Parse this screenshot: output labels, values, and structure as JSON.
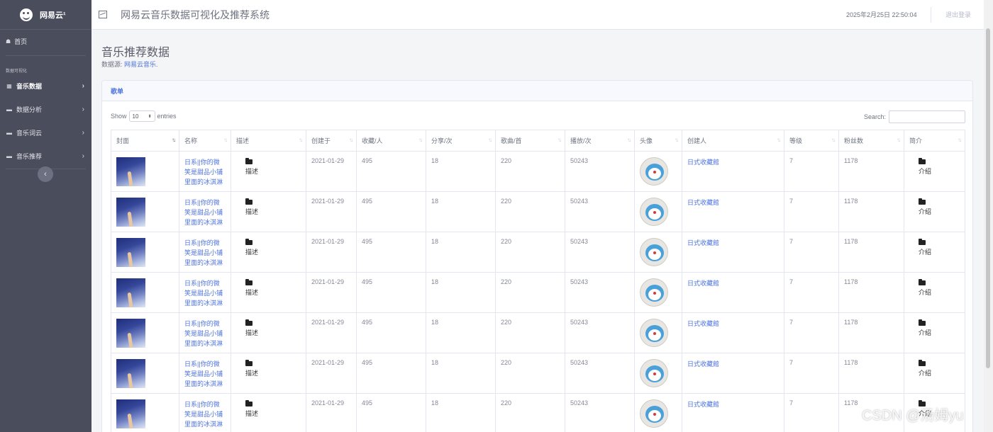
{
  "brand": {
    "name": "网易云¹"
  },
  "sidebar": {
    "home_label": "首页",
    "section_heading": "数据可视化",
    "items": [
      {
        "label": "音乐数据",
        "icon": "table-icon",
        "active": true
      },
      {
        "label": "数据分析",
        "icon": "folder-icon",
        "active": false
      },
      {
        "label": "音乐词云",
        "icon": "folder-icon",
        "active": false
      },
      {
        "label": "音乐推荐",
        "icon": "folder-icon",
        "active": false
      }
    ],
    "collapse_glyph": "‹"
  },
  "topbar": {
    "title": "网易云音乐数据可视化及推荐系统",
    "datetime": "2025年2月25日 22:50:04",
    "logout_label": "退出登录"
  },
  "page": {
    "title": "音乐推荐数据",
    "source_prefix": "数据源: ",
    "source_link": "网易云音乐."
  },
  "card": {
    "title": "歌单",
    "show_label": "Show",
    "entries_value": "10",
    "entries_label": "entries",
    "search_label": "Search:"
  },
  "table": {
    "columns": [
      "封面",
      "名称",
      "描述",
      "创建于",
      "收藏/人",
      "分享/次",
      "歌曲/首",
      "播放/次",
      "头像",
      "创建人",
      "等级",
      "粉丝数",
      "简介"
    ],
    "rows": [
      {
        "name": "日系||你的微笑是甜品小铺里面的冰淇淋",
        "desc_label": "描述",
        "created": "2021-01-29",
        "favorites": "495",
        "shares": "18",
        "songs": "220",
        "plays": "50243",
        "creator": "日式收藏館",
        "level": "7",
        "fans": "1178",
        "intro_label": "介绍"
      },
      {
        "name": "日系||你的微笑是甜品小铺里面的冰淇淋",
        "desc_label": "描述",
        "created": "2021-01-29",
        "favorites": "495",
        "shares": "18",
        "songs": "220",
        "plays": "50243",
        "creator": "日式收藏館",
        "level": "7",
        "fans": "1178",
        "intro_label": "介绍"
      },
      {
        "name": "日系||你的微笑是甜品小铺里面的冰淇淋",
        "desc_label": "描述",
        "created": "2021-01-29",
        "favorites": "495",
        "shares": "18",
        "songs": "220",
        "plays": "50243",
        "creator": "日式收藏館",
        "level": "7",
        "fans": "1178",
        "intro_label": "介绍"
      },
      {
        "name": "日系||你的微笑是甜品小铺里面的冰淇淋",
        "desc_label": "描述",
        "created": "2021-01-29",
        "favorites": "495",
        "shares": "18",
        "songs": "220",
        "plays": "50243",
        "creator": "日式收藏館",
        "level": "7",
        "fans": "1178",
        "intro_label": "介绍"
      },
      {
        "name": "日系||你的微笑是甜品小铺里面的冰淇淋",
        "desc_label": "描述",
        "created": "2021-01-29",
        "favorites": "495",
        "shares": "18",
        "songs": "220",
        "plays": "50243",
        "creator": "日式收藏館",
        "level": "7",
        "fans": "1178",
        "intro_label": "介绍"
      },
      {
        "name": "日系||你的微笑是甜品小铺里面的冰淇淋",
        "desc_label": "描述",
        "created": "2021-01-29",
        "favorites": "495",
        "shares": "18",
        "songs": "220",
        "plays": "50243",
        "creator": "日式收藏館",
        "level": "7",
        "fans": "1178",
        "intro_label": "介绍"
      },
      {
        "name": "日系||你的微笑是甜品小铺里面的冰淇淋",
        "desc_label": "描述",
        "created": "2021-01-29",
        "favorites": "495",
        "shares": "18",
        "songs": "220",
        "plays": "50243",
        "creator": "日式收藏館",
        "level": "7",
        "fans": "1178",
        "intro_label": "介绍"
      }
    ]
  },
  "watermark": "CSDN @汤姆yu",
  "colors": {
    "sidebar_bg": "#4a4d5c",
    "accent": "#4e73df",
    "page_bg": "#f4f5f7"
  }
}
